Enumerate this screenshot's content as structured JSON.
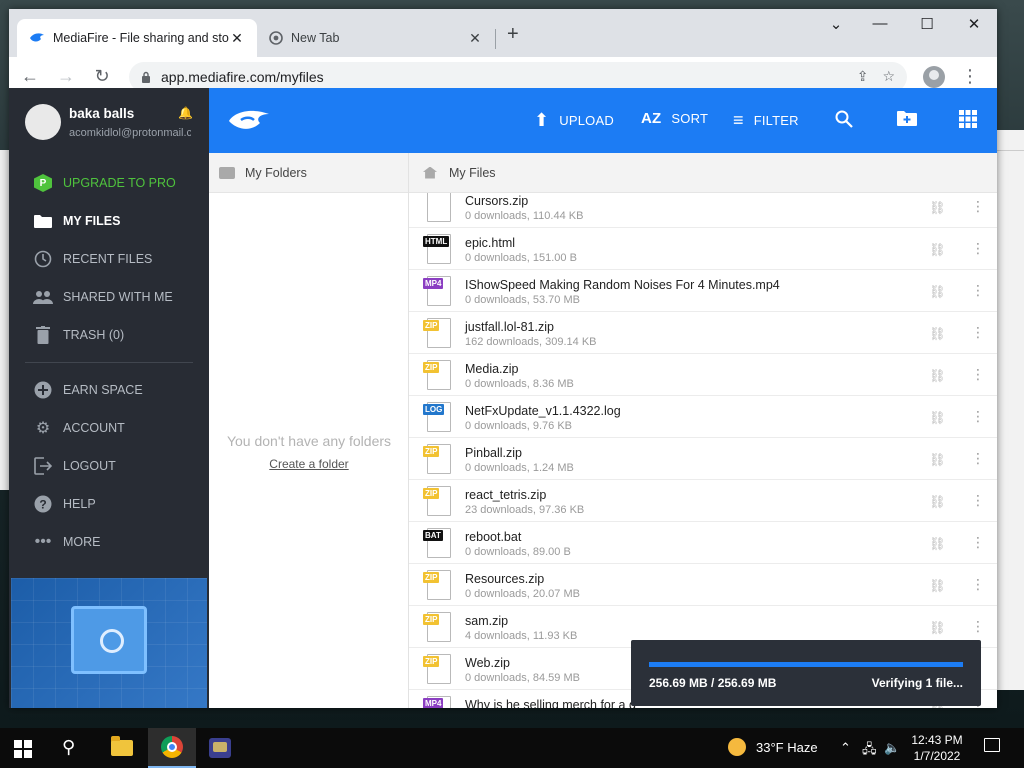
{
  "browser": {
    "tabs": [
      {
        "title": "MediaFire - File sharing and storage",
        "active": true
      },
      {
        "title": "New Tab",
        "active": false
      }
    ],
    "url": "app.mediafire.com/myfiles"
  },
  "user": {
    "name": "baka balls",
    "email": "acomkidlol@protonmail.com"
  },
  "sidebar": {
    "items": [
      {
        "label": "UPGRADE TO PRO",
        "icon": "pro-icon"
      },
      {
        "label": "MY FILES",
        "icon": "folder-icon"
      },
      {
        "label": "RECENT FILES",
        "icon": "clock-icon"
      },
      {
        "label": "SHARED WITH ME",
        "icon": "people-icon"
      },
      {
        "label": "TRASH (0)",
        "icon": "trash-icon"
      }
    ],
    "items2": [
      {
        "label": "EARN SPACE",
        "icon": "plus-icon"
      },
      {
        "label": "ACCOUNT",
        "icon": "gear-icon"
      },
      {
        "label": "LOGOUT",
        "icon": "logout-icon"
      },
      {
        "label": "HELP",
        "icon": "help-icon"
      },
      {
        "label": "MORE",
        "icon": "more-icon"
      }
    ],
    "pro_badge": "P"
  },
  "topbar": {
    "upload": "UPLOAD",
    "sort": "SORT",
    "filter": "FILTER",
    "sort_icon": "AZ"
  },
  "folders": {
    "header": "My Folders",
    "empty_message": "You don't have any folders",
    "create_link": "Create a folder"
  },
  "files": {
    "header": "My Files",
    "items": [
      {
        "name": "Cursors.zip",
        "meta": "0 downloads, 110.44 KB",
        "badge": "",
        "badge_color": "#f2c232"
      },
      {
        "name": "epic.html",
        "meta": "0 downloads, 151.00 B",
        "badge": "HTML",
        "badge_color": "#111111"
      },
      {
        "name": "IShowSpeed Making Random Noises For 4 Minutes.mp4",
        "meta": "0 downloads, 53.70 MB",
        "badge": "MP4",
        "badge_color": "#8b3ec2"
      },
      {
        "name": "justfall.lol-81.zip",
        "meta": "162 downloads, 309.14 KB",
        "badge": "ZIP",
        "badge_color": "#f2c232"
      },
      {
        "name": "Media.zip",
        "meta": "0 downloads, 8.36 MB",
        "badge": "ZIP",
        "badge_color": "#f2c232"
      },
      {
        "name": "NetFxUpdate_v1.1.4322.log",
        "meta": "0 downloads, 9.76 KB",
        "badge": "LOG",
        "badge_color": "#2277cc"
      },
      {
        "name": "Pinball.zip",
        "meta": "0 downloads, 1.24 MB",
        "badge": "ZIP",
        "badge_color": "#f2c232"
      },
      {
        "name": "react_tetris.zip",
        "meta": "23 downloads, 97.36 KB",
        "badge": "ZIP",
        "badge_color": "#f2c232"
      },
      {
        "name": "reboot.bat",
        "meta": "0 downloads, 89.00 B",
        "badge": "BAT",
        "badge_color": "#111111"
      },
      {
        "name": "Resources.zip",
        "meta": "0 downloads, 20.07 MB",
        "badge": "ZIP",
        "badge_color": "#f2c232"
      },
      {
        "name": "sam.zip",
        "meta": "4 downloads, 11.93 KB",
        "badge": "ZIP",
        "badge_color": "#f2c232"
      },
      {
        "name": "Web.zip",
        "meta": "0 downloads, 84.59 MB",
        "badge": "ZIP",
        "badge_color": "#f2c232"
      },
      {
        "name": "Why is he selling merch for a d",
        "meta": "",
        "badge": "MP4",
        "badge_color": "#8b3ec2"
      }
    ]
  },
  "upload_panel": {
    "size": "256.69 MB / 256.69 MB",
    "status": "Verifying 1 file...",
    "progress": 1.0
  },
  "taskbar": {
    "weather": "33°F  Haze",
    "time": "12:43 PM",
    "date": "1/7/2022"
  },
  "colors": {
    "accent": "#1c7cf4",
    "sidebar": "#282c34",
    "pro": "#4fc33d"
  }
}
